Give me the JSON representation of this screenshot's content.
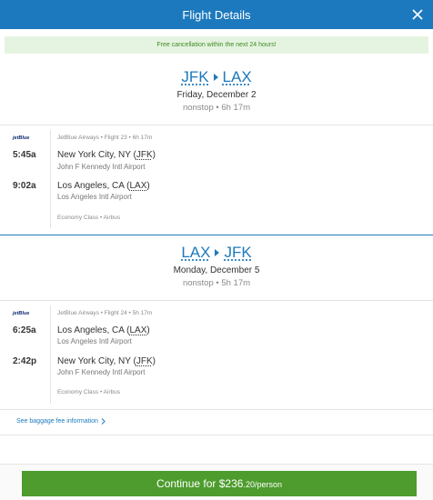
{
  "header": {
    "title": "Flight Details"
  },
  "notice": "Free cancellation within the next 24 hours!",
  "legs": [
    {
      "origin": "JFK",
      "destination": "LAX",
      "date": "Friday, December 2",
      "meta": "nonstop • 6h 17m",
      "airline_logo": "jetBlue",
      "flight_info": "JetBlue Airways • Flight 23 • 6h 17m",
      "depart_time": "5:45a",
      "depart_city": "New York City, NY",
      "depart_code": "JFK",
      "depart_airport": "John F Kennedy Intl Airport",
      "arrive_time": "9:02a",
      "arrive_city": "Los Angeles, CA",
      "arrive_code": "LAX",
      "arrive_airport": "Los Angeles Intl Airport",
      "cabin": "Economy Class • Airbus"
    },
    {
      "origin": "LAX",
      "destination": "JFK",
      "date": "Monday, December 5",
      "meta": "nonstop • 5h 17m",
      "airline_logo": "jetBlue",
      "flight_info": "JetBlue Airways • Flight 24 • 5h 17m",
      "depart_time": "6:25a",
      "depart_city": "Los Angeles, CA",
      "depart_code": "LAX",
      "depart_airport": "Los Angeles Intl Airport",
      "arrive_time": "2:42p",
      "arrive_city": "New York City, NY",
      "arrive_code": "JFK",
      "arrive_airport": "John F Kennedy Intl Airport",
      "cabin": "Economy Class • Airbus"
    }
  ],
  "baggage_link": "See baggage fee information",
  "continue": {
    "label": "Continue for $236",
    "cents": ".20/person"
  },
  "colors": {
    "brand": "#1d79bd",
    "notice_bg": "#e5f4e0",
    "notice_text": "#3d8b23",
    "continue": "#4d9c2d"
  },
  "icons": {
    "close": "close-icon",
    "route_arrow": "route-arrow-icon",
    "baggage_chevron": "chevron-right-icon"
  }
}
